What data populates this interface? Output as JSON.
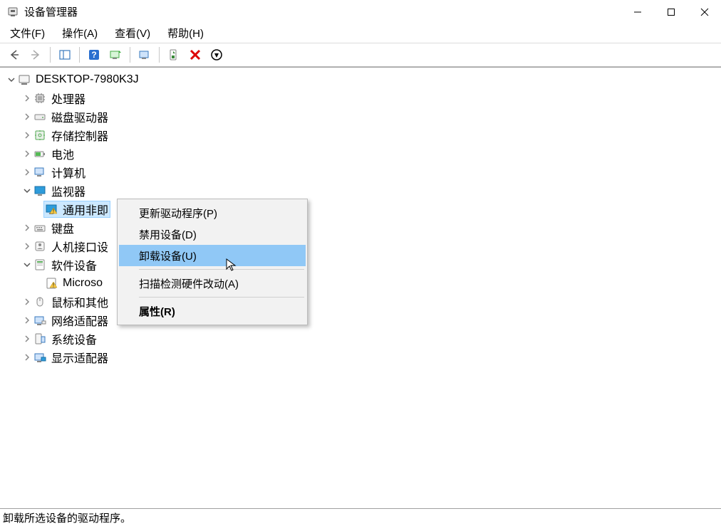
{
  "titlebar": {
    "title": "设备管理器"
  },
  "menubar": {
    "file": "文件(F)",
    "action": "操作(A)",
    "view": "查看(V)",
    "help": "帮助(H)"
  },
  "tree": {
    "root": "DESKTOP-7980K3J",
    "items": [
      {
        "label": "处理器",
        "icon": "cpu"
      },
      {
        "label": "磁盘驱动器",
        "icon": "disk"
      },
      {
        "label": "存储控制器",
        "icon": "storage"
      },
      {
        "label": "电池",
        "icon": "battery"
      },
      {
        "label": "计算机",
        "icon": "computer"
      },
      {
        "label": "监视器",
        "icon": "monitor",
        "expanded": true,
        "children": [
          {
            "label": "通用非即",
            "icon": "monitor-warn",
            "selected": true
          }
        ]
      },
      {
        "label": "键盘",
        "icon": "keyboard"
      },
      {
        "label": "人机接口设",
        "icon": "hid"
      },
      {
        "label": "软件设备",
        "icon": "software",
        "expanded": true,
        "children": [
          {
            "label": "Microso",
            "icon": "software-warn"
          }
        ]
      },
      {
        "label": "鼠标和其他",
        "icon": "mouse"
      },
      {
        "label": "网络适配器",
        "icon": "network"
      },
      {
        "label": "系统设备",
        "icon": "system"
      },
      {
        "label": "显示适配器",
        "icon": "display"
      }
    ]
  },
  "context_menu": {
    "update_driver": "更新驱动程序(P)",
    "disable": "禁用设备(D)",
    "uninstall": "卸载设备(U)",
    "scan": "扫描检测硬件改动(A)",
    "properties": "属性(R)"
  },
  "statusbar": {
    "text": "卸载所选设备的驱动程序。"
  }
}
